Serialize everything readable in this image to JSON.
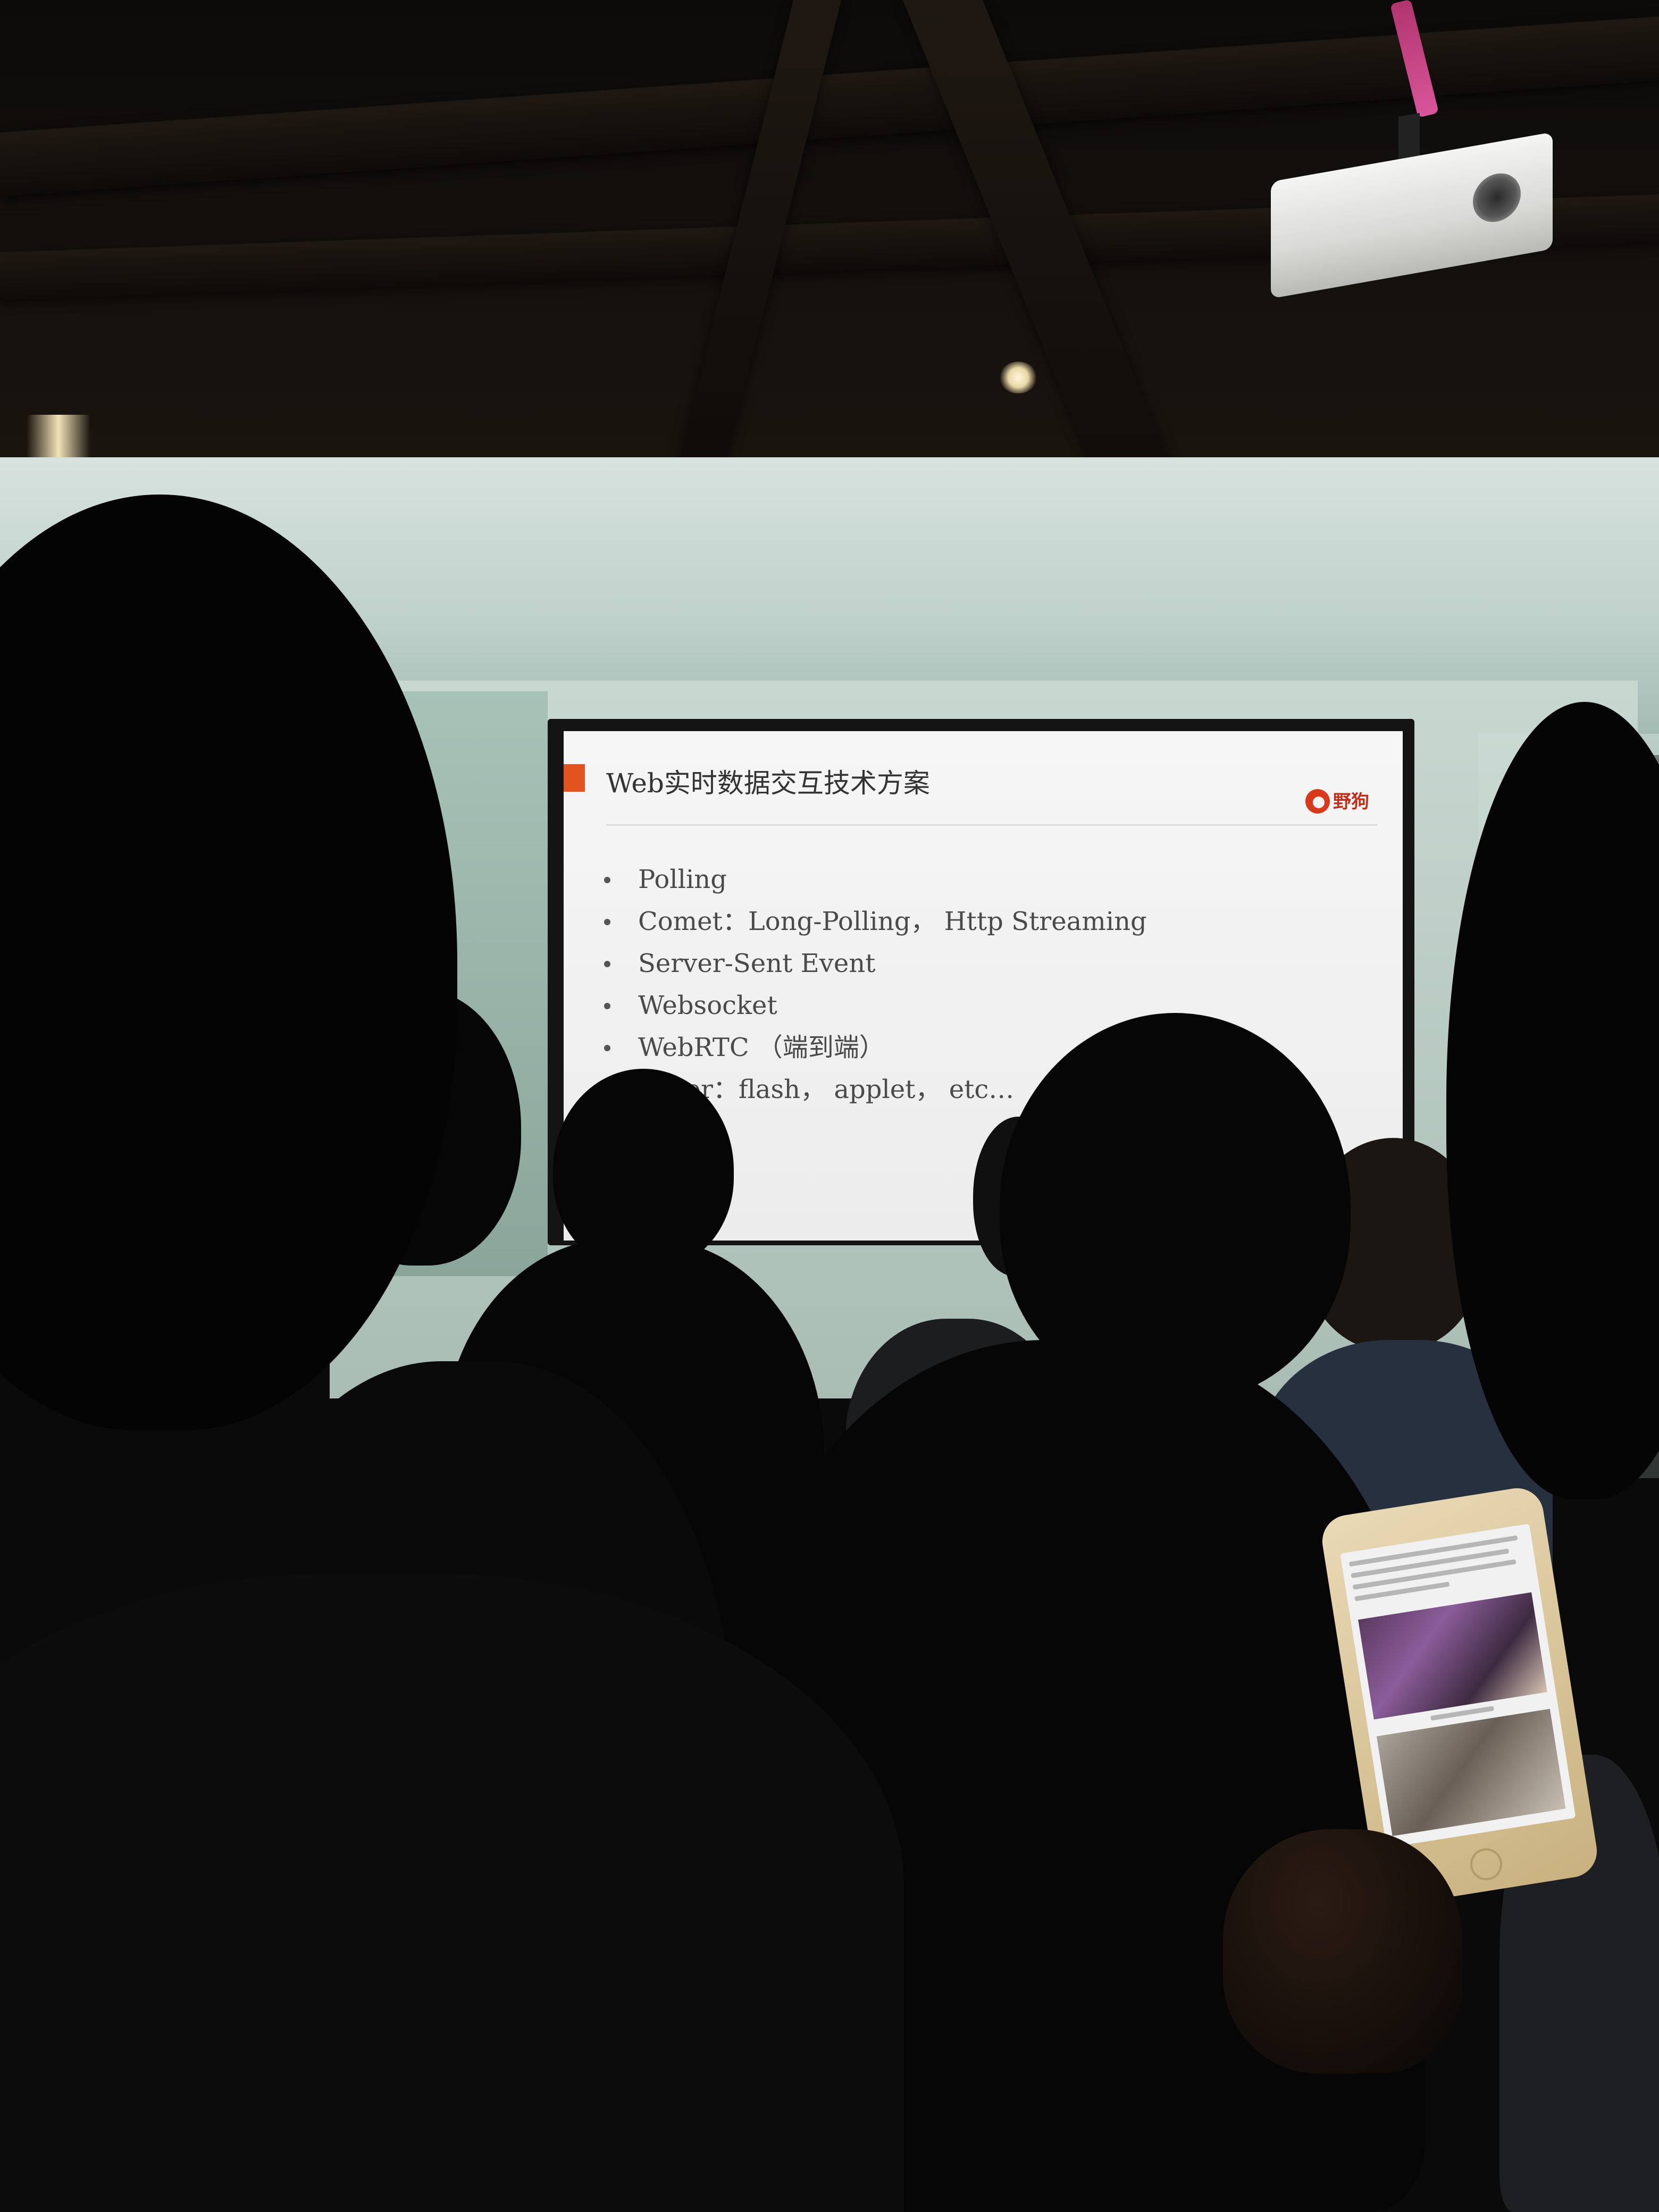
{
  "slide": {
    "title": "Web实时数据交互技术方案",
    "logo_text": "野狗",
    "bullets": [
      "Polling",
      "Comet：Long-Polling，  Http Streaming",
      "Server-Sent Event",
      "Websocket",
      "WebRTC （端到端）",
      "Other：flash， applet， etc…"
    ]
  },
  "colors": {
    "slide_accent": "#e2541f",
    "logo": "#c52c17",
    "wall": "#c7d8d1",
    "projector_ribbon": "#d9559a"
  }
}
